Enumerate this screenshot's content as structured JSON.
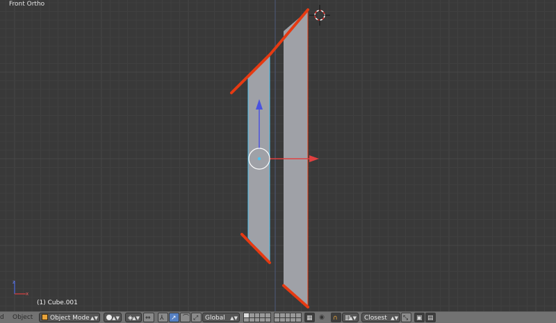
{
  "viewport": {
    "view_label": "Front Ortho",
    "object_info": "(1) Cube.001",
    "colors": {
      "background": "#393939",
      "edge_highlight": "#e63a12",
      "face": "#9ea0a6",
      "selected_outline": "#4fc3ef"
    }
  },
  "header": {
    "menu_view_partial": "d",
    "menu_object": "Object",
    "mode_label": "Object Mode",
    "orientation_label": "Global",
    "snap_target_label": "Closest"
  },
  "icons": [
    "editor-type-icon",
    "cube-mode-icon",
    "viewport-shading-icon",
    "pivot-point-icon",
    "manipulator-icon",
    "translate-icon",
    "rotate-icon",
    "scale-icon",
    "layer-lock-icon",
    "proportional-edit-icon",
    "magnet-snap-icon",
    "snap-element-icon",
    "snap-align-icon",
    "opengl-render-icon",
    "opengl-render-anim-icon",
    "3d-cursor-icon",
    "axis-widget-icon"
  ]
}
